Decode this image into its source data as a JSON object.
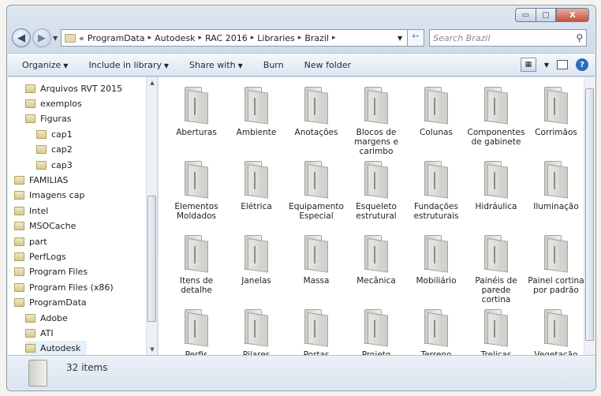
{
  "window": {
    "caption": {
      "minimize": "▭",
      "maximize": "▢",
      "close": "X"
    }
  },
  "address_bar": {
    "prefix": "«",
    "crumbs": [
      "ProgramData",
      "Autodesk",
      "RAC 2016",
      "Libraries",
      "Brazil"
    ],
    "separator": "▸",
    "refresh_icon": "⁴⁺",
    "search_placeholder": "Search Brazil"
  },
  "toolbar": {
    "organize": "Organize",
    "include_in_library": "Include in library",
    "share_with": "Share with",
    "burn": "Burn",
    "new_folder": "New folder"
  },
  "nav_pane": {
    "items": [
      {
        "label": "Arquivos RVT 2015",
        "level": 2
      },
      {
        "label": "exemplos",
        "level": 2
      },
      {
        "label": "Figuras",
        "level": 2
      },
      {
        "label": "cap1",
        "level": 3
      },
      {
        "label": "cap2",
        "level": 3
      },
      {
        "label": "cap3",
        "level": 3
      },
      {
        "label": "FAMILIAS",
        "level": 1
      },
      {
        "label": "Imagens cap",
        "level": 1
      },
      {
        "label": "Intel",
        "level": 1
      },
      {
        "label": "MSOCache",
        "level": 1
      },
      {
        "label": "part",
        "level": 1
      },
      {
        "label": "PerfLogs",
        "level": 1
      },
      {
        "label": "Program Files",
        "level": 1
      },
      {
        "label": "Program Files (x86)",
        "level": 1
      },
      {
        "label": "ProgramData",
        "level": 1
      },
      {
        "label": "Adobe",
        "level": 2
      },
      {
        "label": "ATI",
        "level": 2
      },
      {
        "label": "Autodesk",
        "level": 2,
        "selected": true
      }
    ]
  },
  "content": {
    "folders": [
      "Aberturas",
      "Ambiente",
      "Anotações",
      "Blocos de margens e carimbo",
      "Colunas",
      "Componentes de gabinete",
      "Corrimãos",
      "Elementos Moldados",
      "Elétrica",
      "Equipamento Especial",
      "Esqueleto estrutural",
      "Fundações estruturais",
      "Hidráulica",
      "Iluminação",
      "Itens de detalhe",
      "Janelas",
      "Massa",
      "Mecânica",
      "Mobiliário",
      "Painéis de parede cortina",
      "Painel cortina por padrão",
      "Perfis",
      "Pilares estruturais",
      "Portas",
      "Projeto sustentável",
      "Terreno",
      "Treliças estruturais",
      "Vegetação"
    ]
  },
  "details": {
    "item_count": "32 items"
  }
}
